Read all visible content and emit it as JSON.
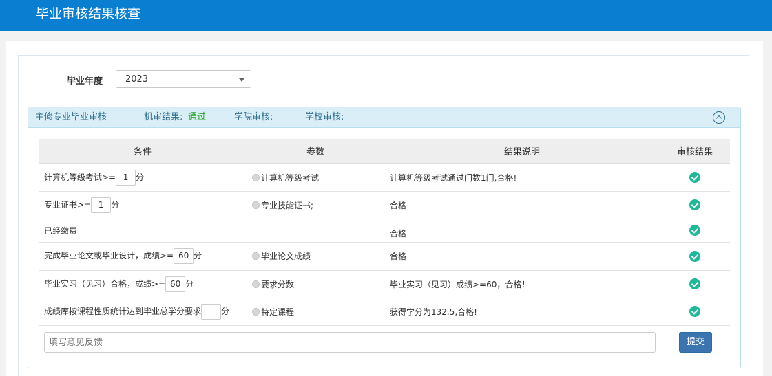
{
  "header": {
    "title": "毕业审核结果核查"
  },
  "filter": {
    "year_label": "毕业年度",
    "year_value": "2023"
  },
  "panel": {
    "title": "主修专业毕业审核",
    "machine_label": "机审结果",
    "machine_sep": ":",
    "machine_value": "通过",
    "college_label": "学院审核:",
    "school_label": "学校审核:"
  },
  "table": {
    "headers": [
      "条件",
      "参数",
      "结果说明",
      "审核结果"
    ],
    "rows": [
      {
        "cond_pre": "计算机等级考试>=",
        "cond_value": "1",
        "cond_post": "分",
        "param": "计算机等级考试",
        "result": "计算机等级考试通过门数1门,合格!"
      },
      {
        "cond_pre": "专业证书>=",
        "cond_value": "1",
        "cond_post": "分",
        "param": "专业技能证书;",
        "result": "合格"
      },
      {
        "cond_pre": "已经缴费",
        "cond_value": "",
        "cond_post": "",
        "param": "",
        "result": "合格"
      },
      {
        "cond_pre": "完成毕业论文或毕业设计，成绩>=",
        "cond_value": "60",
        "cond_post": "分",
        "param": "毕业论文成绩",
        "result": "合格"
      },
      {
        "cond_pre": "毕业实习（见习）合格，成绩>=",
        "cond_value": "60",
        "cond_post": "分",
        "param": "要求分数",
        "result": "毕业实习（见习）成绩>=60，合格！"
      },
      {
        "cond_pre": "成绩库按课程性质统计达到毕业总学分要求",
        "cond_value": "",
        "cond_post": "分",
        "param": "特定课程",
        "result": "获得学分为132.5,合格!"
      }
    ]
  },
  "feedback": {
    "placeholder": "填写意见反馈",
    "submit_label": "提交"
  },
  "colors": {
    "topbar": "#0a7fd1",
    "panel_head": "#d9eef7",
    "pass": "#2aa52a",
    "check": "#1fb99a",
    "submit": "#3a75b0"
  }
}
